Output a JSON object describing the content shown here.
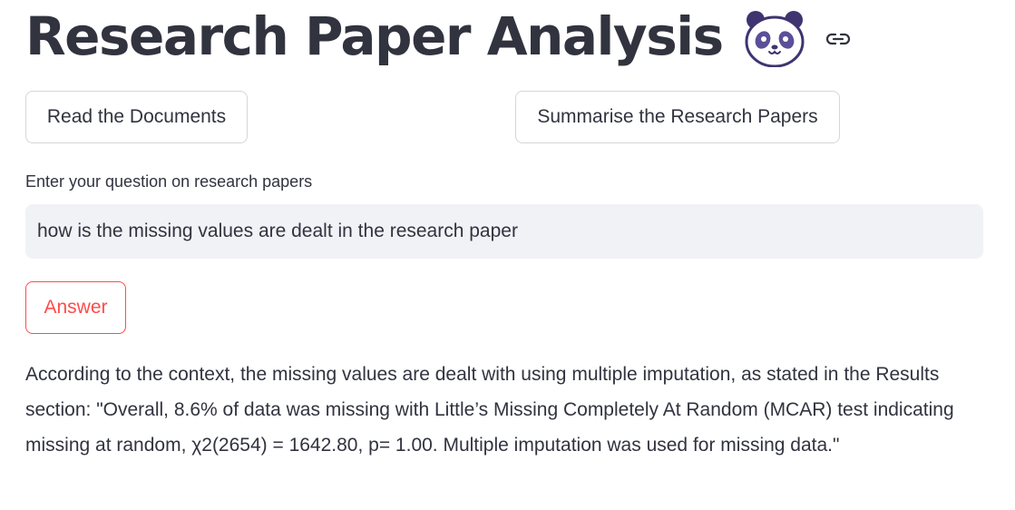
{
  "header": {
    "title": "Research Paper Analysis",
    "emoji_icon": "panda-face-icon",
    "anchor_icon": "link-icon"
  },
  "actions": {
    "read_label": "Read the Documents",
    "summarise_label": "Summarise the Research Papers"
  },
  "question": {
    "label": "Enter your question on research papers",
    "value": "how is the missing values are dealt in the research paper"
  },
  "answer_button": {
    "label": "Answer"
  },
  "response": {
    "text": "According to the context, the missing values are dealt with using multiple imputation, as stated in the Results section: \"Overall, 8.6% of data was missing with Little’s Missing Completely At Random (MCAR) test indicating missing at random, χ2(2654) = 1642.80, p= 1.00. Multiple imputation was used for missing data.\""
  },
  "colors": {
    "text": "#31333f",
    "primary": "#ff4b4b",
    "input_bg": "#f0f2f6",
    "border": "#d6d6d9"
  }
}
